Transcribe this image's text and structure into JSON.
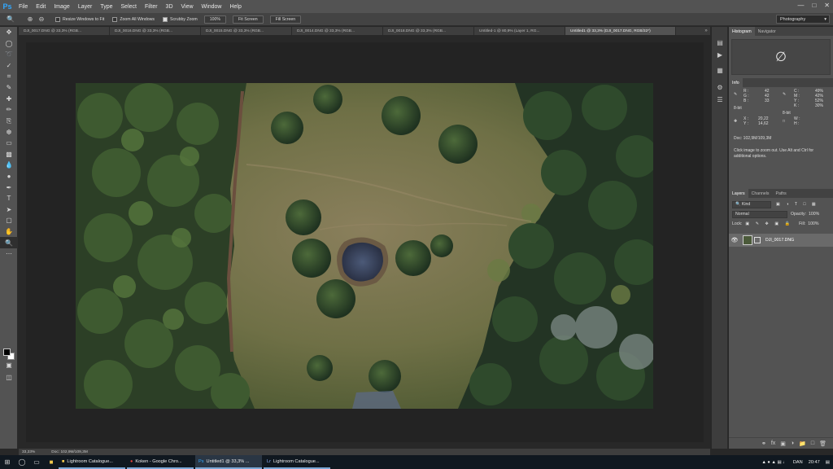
{
  "menubar": {
    "logo": "Ps",
    "items": [
      "File",
      "Edit",
      "Image",
      "Layer",
      "Type",
      "Select",
      "Filter",
      "3D",
      "View",
      "Window",
      "Help"
    ]
  },
  "options": {
    "resize_windows": "Resize Windows to Fit",
    "zoom_all": "Zoom All Windows",
    "scrubby_zoom": "Scrubby Zoom",
    "zoom_pct": "100%",
    "fit_screen": "Fit Screen",
    "fill_screen": "Fill Screen",
    "workspace": "Photography"
  },
  "tabs": [
    "DJI_0017.DNG @ 33,3% (RGB...",
    "DJI_0016.DNG @ 33,3% (RGB...",
    "DJI_0015.DNG @ 33,3% (RGB...",
    "DJI_0014.DNG @ 33,3% (RGB...",
    "DJI_0018.DNG @ 33,3% (RGB...",
    "Untitled-1 @ 80,9% (Layer 1, RG...",
    "Untitled1 @ 33,3% (DJI_0017.DNG, RGB/32*)"
  ],
  "panels": {
    "histogram_tab": "Histogram",
    "navigator_tab": "Navigator",
    "info_tab": "Info",
    "info": {
      "r_label": "R :",
      "r": "42",
      "g_label": "G :",
      "g": "42",
      "b_label": "B :",
      "b": "33",
      "c_label": "C :",
      "c": "49%",
      "m_label": "M :",
      "m": "42%",
      "y_label": "Y :",
      "y": "52%",
      "k_label": "K :",
      "k": "30%",
      "bits_left": "8-bit",
      "bits_right": "8-bit",
      "x_label": "X :",
      "x": "20,22",
      "y2_label": "Y :",
      "y2": "14,62",
      "w_label": "W :",
      "h_label": "H :"
    },
    "doc_size": "Doc: 102,9M/109,3M",
    "info_msg": "Click image to zoom out. Use Alt and Ctrl for additional options.",
    "layers_tab": "Layers",
    "channels_tab": "Channels",
    "paths_tab": "Paths",
    "kind": "Kind",
    "blend_mode": "Normal",
    "opacity_label": "Opacity:",
    "opacity": "100%",
    "lock_label": "Lock:",
    "fill_label": "Fill:",
    "fill": "100%",
    "layer_name": "DJI_0017.DNG"
  },
  "status": {
    "zoom": "33,33%",
    "doc": "Doc: 102,9M/109,3M"
  },
  "taskbar": {
    "apps": [
      "Lightroom Catalogue...",
      "Koken - Google Chro...",
      "Untitled1 @ 33,3% ...",
      "Lightroom Catalogue..."
    ],
    "lang": "DAN",
    "time": "20:47"
  }
}
